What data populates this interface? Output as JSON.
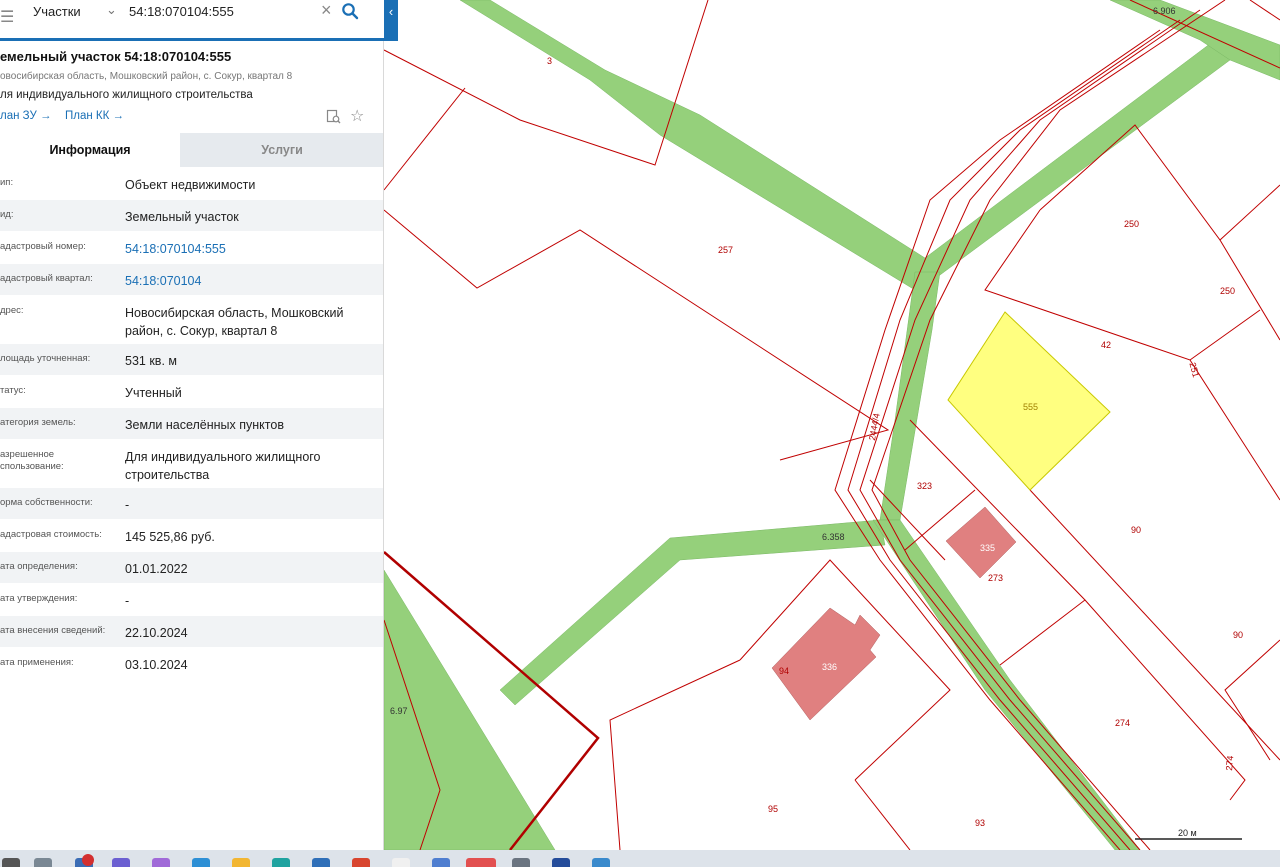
{
  "search": {
    "type_label": "Участки",
    "query": "54:18:070104:555"
  },
  "parcel": {
    "title": "емельный участок 54:18:070104:555",
    "address_short": "овосибирская область, Мошковский район, с. Сокур, квартал 8",
    "use_short": "ля индивидуального жилищного строительства",
    "plan_zu": "лан ЗУ →",
    "plan_kk": "План КК →"
  },
  "tabs": {
    "info": "Информация",
    "services": "Услуги"
  },
  "attributes": [
    {
      "key": "ип:",
      "value": "Объект недвижимости"
    },
    {
      "key": "ид:",
      "value": "Земельный участок"
    },
    {
      "key": "адастровый номер:",
      "value": "54:18:070104:555"
    },
    {
      "key": "адастровый квартал:",
      "value": "54:18:070104"
    },
    {
      "key": "дрес:",
      "value": "Новосибирская область, Мошковский район, с. Сокур, квартал 8"
    },
    {
      "key": "лощадь уточненная:",
      "value": "531 кв. м"
    },
    {
      "key": "татус:",
      "value": "Учтенный"
    },
    {
      "key": "атегория земель:",
      "value": "Земли населённых пунктов"
    },
    {
      "key": "азрешенное\nспользование:",
      "value": "Для индивидуального жилищного строительства"
    },
    {
      "key": "орма собственности:",
      "value": "-"
    },
    {
      "key": "адастровая стоимость:",
      "value": "145 525,86 руб."
    },
    {
      "key": "ата определения:",
      "value": "01.01.2022"
    },
    {
      "key": "ата утверждения:",
      "value": "-"
    },
    {
      "key": "ата внесения сведений:",
      "value": "22.10.2024"
    },
    {
      "key": "ата применения:",
      "value": "03.10.2024"
    }
  ],
  "map_labels": {
    "l3": "3",
    "l6906": "6.906",
    "l257": "257",
    "l250a": "250",
    "l250b": "250",
    "l251": "251",
    "l42": "42",
    "l555": "555",
    "l2444": "2444/4",
    "l323": "323",
    "l335": "335",
    "l273": "273",
    "l90a": "90",
    "l90b": "90",
    "l6358": "6.358",
    "l336": "336",
    "l94": "94",
    "l697": "6.97",
    "l274a": "274",
    "l274b": "274",
    "l95": "95",
    "l93": "93",
    "scale": "20 м"
  },
  "colors": {
    "road": "#95d07b",
    "selected_parcel": "#ffff80",
    "building": "#e08080",
    "boundary": "#c00000",
    "accent": "#1a6fb5"
  }
}
